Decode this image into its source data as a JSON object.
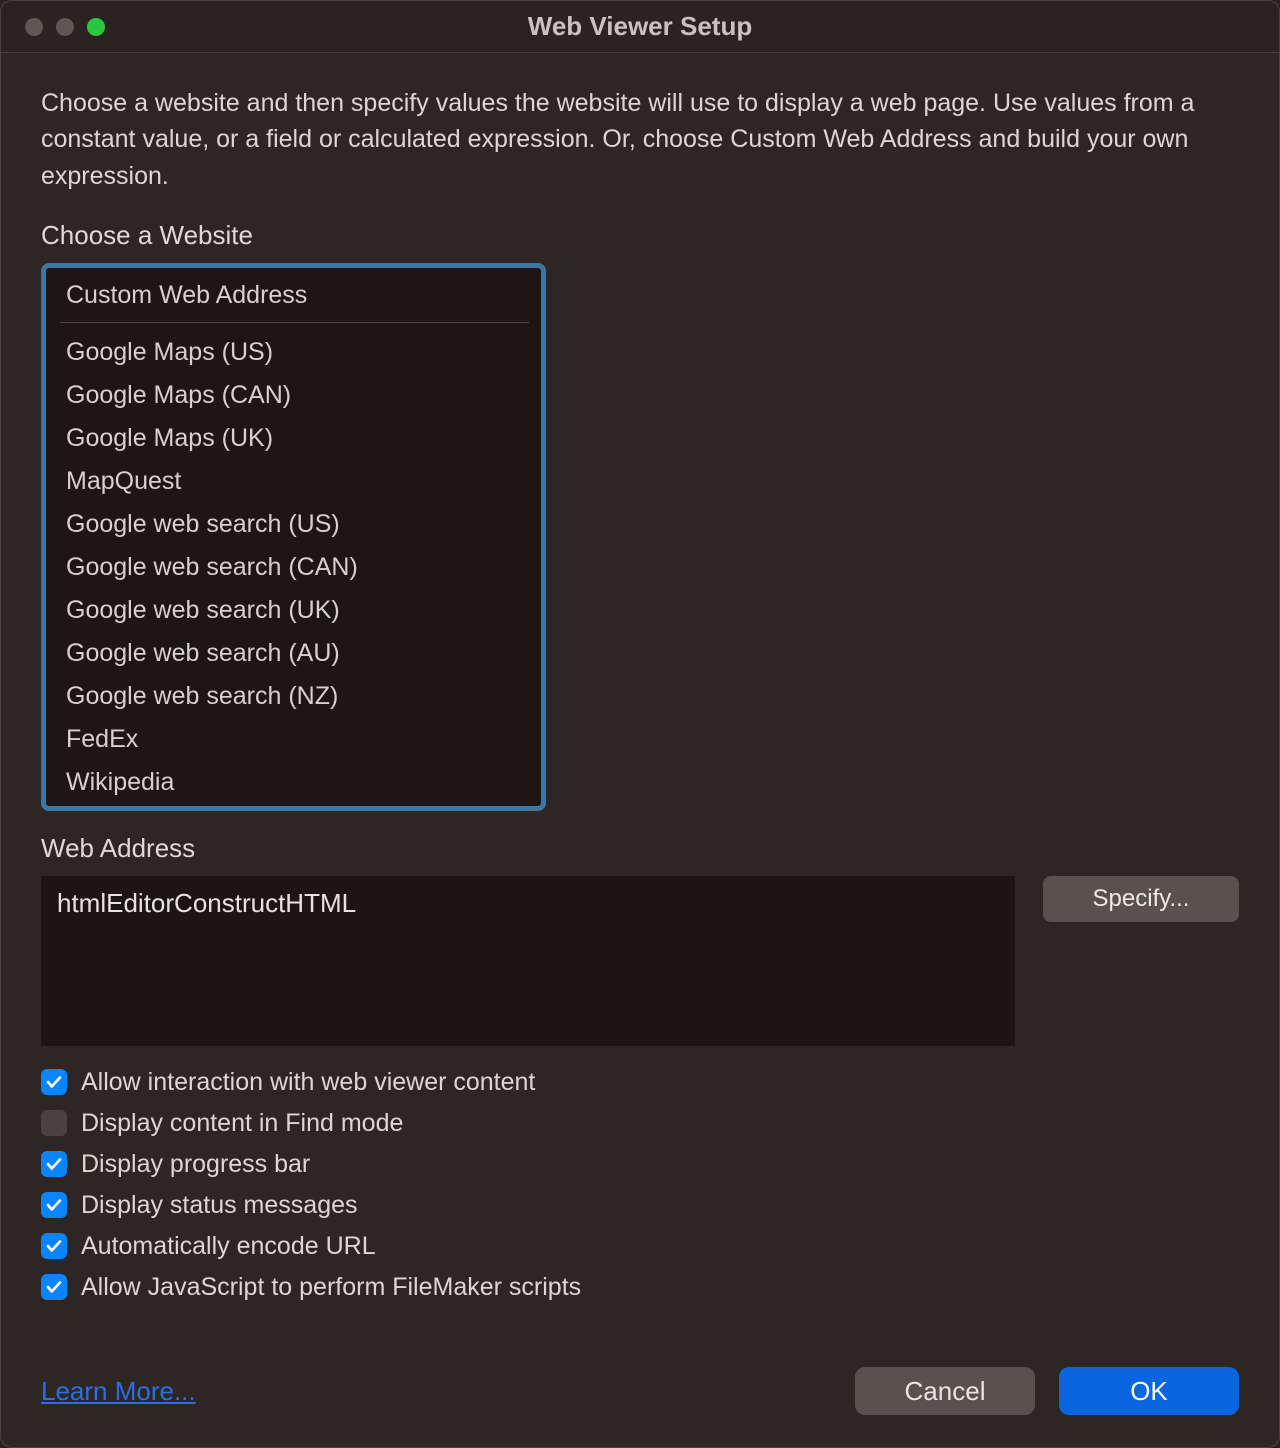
{
  "window": {
    "title": "Web Viewer Setup"
  },
  "intro": "Choose a website and then specify values the website will use to display a web page. Use values from a constant value, or a field or calculated expression. Or, choose Custom Web Address and build your own expression.",
  "choose_label": "Choose a Website",
  "websites": [
    "Custom Web Address",
    "Google Maps (US)",
    "Google Maps (CAN)",
    "Google Maps (UK)",
    "MapQuest",
    "Google web search (US)",
    "Google web search (CAN)",
    "Google web search (UK)",
    "Google web search (AU)",
    "Google web search (NZ)",
    "FedEx",
    "Wikipedia"
  ],
  "web_address": {
    "label": "Web Address",
    "value": "htmlEditorConstructHTML",
    "specify_label": "Specify..."
  },
  "checks": [
    {
      "label": "Allow interaction with web viewer content",
      "checked": true
    },
    {
      "label": "Display content in Find mode",
      "checked": false
    },
    {
      "label": "Display progress bar",
      "checked": true
    },
    {
      "label": "Display status messages",
      "checked": true
    },
    {
      "label": "Automatically encode URL",
      "checked": true
    },
    {
      "label": "Allow JavaScript to perform FileMaker scripts",
      "checked": true
    }
  ],
  "footer": {
    "learn_more": "Learn More...",
    "cancel": "Cancel",
    "ok": "OK"
  }
}
